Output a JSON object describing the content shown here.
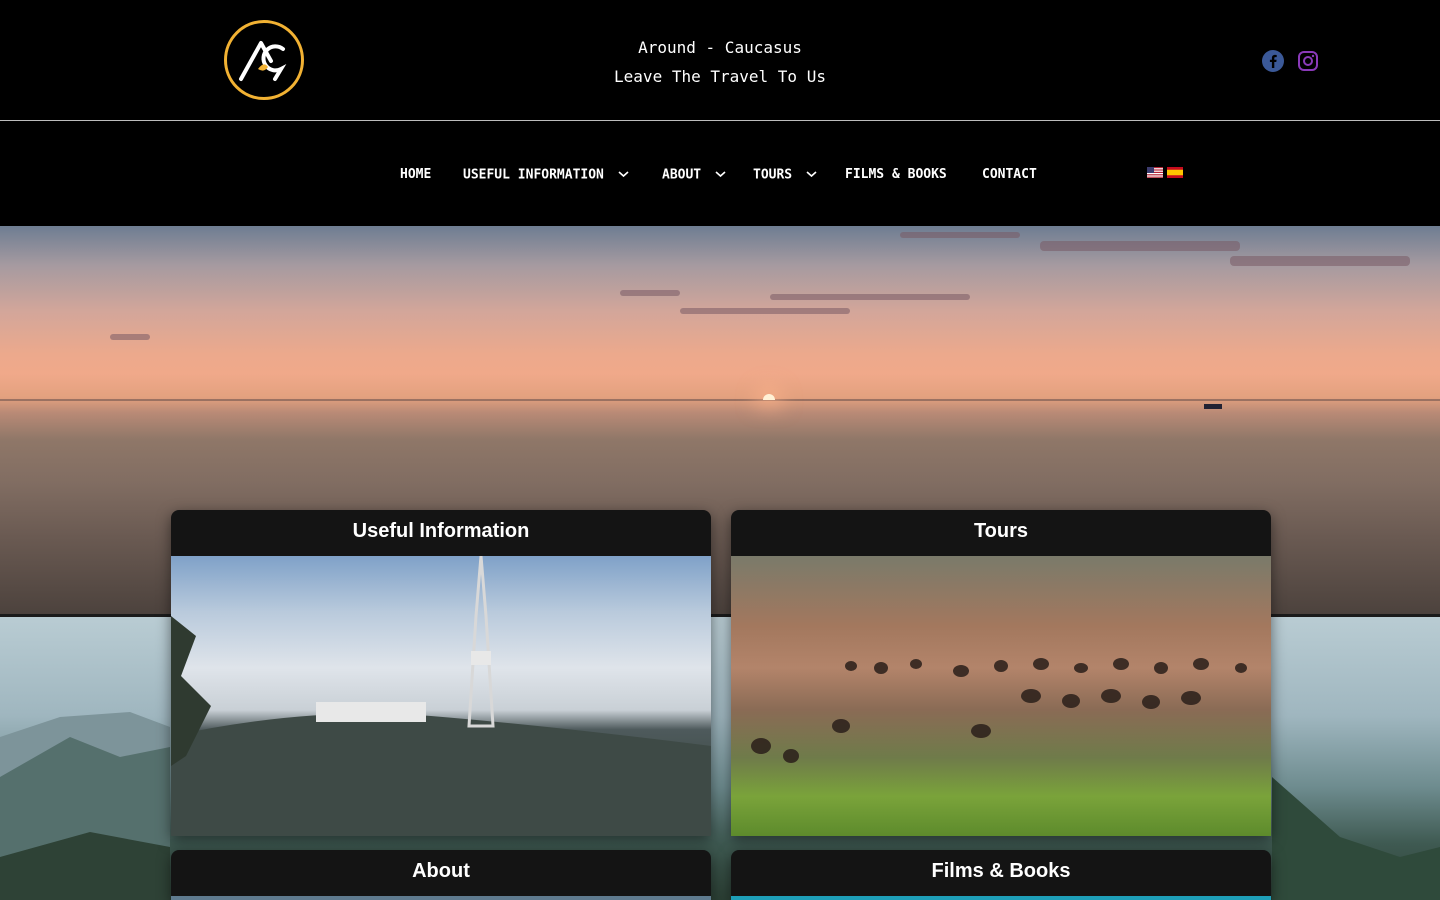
{
  "header": {
    "site_name": "Around - Caucasus",
    "slogan": "Leave The Travel To Us",
    "logo_icon": "ac-pin-logo",
    "logo_color": "#f2b233",
    "social": [
      {
        "name": "facebook-icon",
        "color": "#3b5998"
      },
      {
        "name": "instagram-icon",
        "color": "#8a3ab9"
      }
    ]
  },
  "nav": {
    "items": [
      {
        "label": "HOME",
        "has_dropdown": false
      },
      {
        "label": "USEFUL INFORMATION",
        "has_dropdown": true
      },
      {
        "label": "ABOUT",
        "has_dropdown": true
      },
      {
        "label": "TOURS",
        "has_dropdown": true
      },
      {
        "label": "FILMS & BOOKS",
        "has_dropdown": false
      },
      {
        "label": "CONTACT",
        "has_dropdown": false
      }
    ],
    "languages": [
      "us-flag-icon",
      "spain-flag-icon"
    ]
  },
  "cards": [
    {
      "title": "Useful Information",
      "image": "tbilisi-tv-tower-photo"
    },
    {
      "title": "Tours",
      "image": "vardzia-cave-city-photo"
    },
    {
      "title": "About",
      "image": "mountain-photo"
    },
    {
      "title": "Films & Books",
      "image": "lake-photo"
    }
  ],
  "colors": {
    "background": "#000000",
    "card_header": "#141414",
    "accent": "#f2b233"
  }
}
